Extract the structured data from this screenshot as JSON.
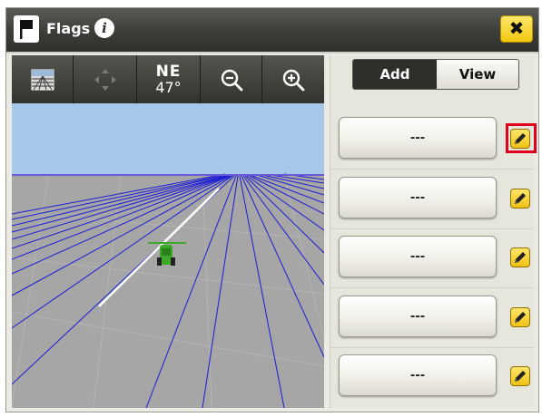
{
  "titlebar": {
    "title": "Flags",
    "flag_icon": "flag-icon",
    "info_icon": "info-icon",
    "info_glyph": "i",
    "close_icon": "close-icon",
    "close_glyph": "✖"
  },
  "map_toolbar": {
    "perspective_icon": "perspective-view-icon",
    "pan_icon": "pan-arrows-icon",
    "heading_direction": "NE",
    "heading_degrees": "47°",
    "zoom_out_icon": "zoom-out-icon",
    "zoom_out_glyph": "−",
    "zoom_in_icon": "zoom-in-icon",
    "zoom_in_glyph": "+"
  },
  "map_view": {
    "sky_color": "#a7c7ea",
    "ground_color": "#a6a6a6",
    "guidance_line_color": "#1c1cd6",
    "vehicle_color": "#3caa28"
  },
  "panel": {
    "tabs": [
      {
        "label": "Add",
        "selected": true
      },
      {
        "label": "View",
        "selected": false
      }
    ],
    "flags": [
      {
        "label": "---",
        "edit_icon": "pencil-icon",
        "highlighted": true
      },
      {
        "label": "---",
        "edit_icon": "pencil-icon",
        "highlighted": false
      },
      {
        "label": "---",
        "edit_icon": "pencil-icon",
        "highlighted": false
      },
      {
        "label": "---",
        "edit_icon": "pencil-icon",
        "highlighted": false
      },
      {
        "label": "---",
        "edit_icon": "pencil-icon",
        "highlighted": false
      }
    ]
  },
  "colors": {
    "accent_yellow": "#f5cf1f",
    "highlight_red": "#e0001a",
    "titlebar_dark": "#3b3d39"
  }
}
